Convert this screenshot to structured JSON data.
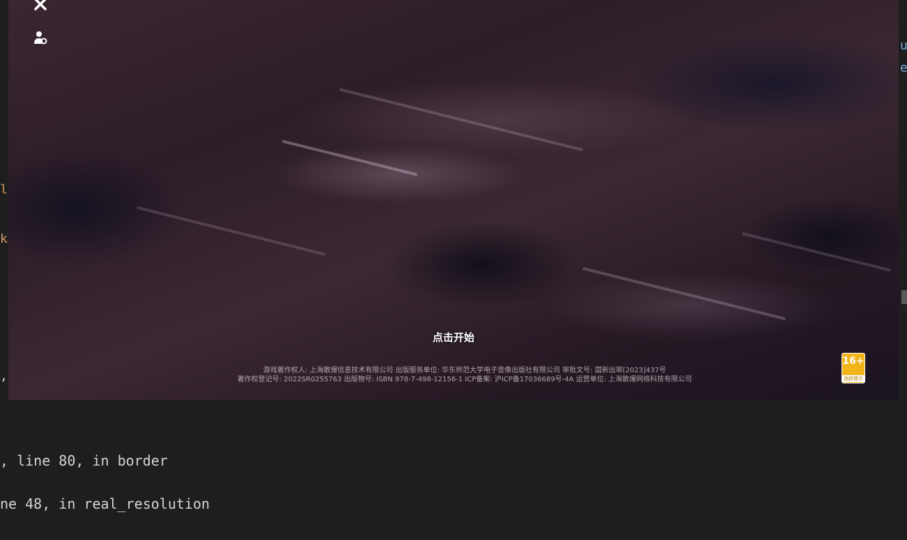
{
  "game": {
    "start_label": "点击开始",
    "copyright_line1": "游戏著作权人: 上海散爆信息技术有限公司 出版服务单位: 华东师范大学电子音像出版社有限公司 审批文号: 国新出审[2023]437号",
    "copyright_line2": "著作权登记号: 2022SR0255763 出版物号: ISBN 978-7-498-12156-1 ICP备案: 沪ICP备17036689号-4A 运营单位: 上海散爆网络科技有限公司",
    "age_rating": "16+",
    "age_caption": "适龄提示",
    "icons": [
      "close-icon",
      "user-settings-icon"
    ]
  },
  "editor": {
    "left_fragments": [
      "li",
      "ka",
      ","
    ],
    "right_fragments": [
      "u",
      "e"
    ]
  },
  "terminal": {
    "lines": [
      ", line 80, in border",
      "ne 48, in real_resolution"
    ]
  },
  "colors": {
    "background": "#1e1e1e",
    "badge": "#f2b418",
    "terminal_text": "#d4d4d4"
  }
}
